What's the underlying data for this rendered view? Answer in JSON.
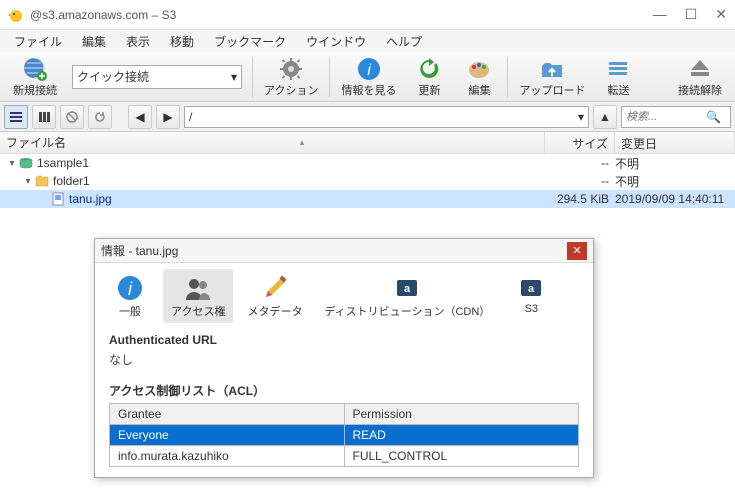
{
  "window": {
    "title": "@s3.amazonaws.com – S3"
  },
  "menu": [
    "ファイル",
    "編集",
    "表示",
    "移動",
    "ブックマーク",
    "ウインドウ",
    "ヘルプ"
  ],
  "toolbar": {
    "new_connection": "新規接続",
    "quick_connect": "クイック接続",
    "action": "アクション",
    "info": "情報を見る",
    "refresh": "更新",
    "edit": "編集",
    "upload": "アップロード",
    "transfer": "転送",
    "disconnect": "接続解除"
  },
  "path": "/",
  "search_placeholder": "検索...",
  "columns": {
    "name": "ファイル名",
    "size": "サイズ",
    "date": "変更日"
  },
  "rows": [
    {
      "name": "1sample1",
      "size": "--",
      "date": "不明",
      "depth": 0,
      "type": "bucket",
      "exp": "▾"
    },
    {
      "name": "folder1",
      "size": "--",
      "date": "不明",
      "depth": 1,
      "type": "folder",
      "exp": "▾"
    },
    {
      "name": "tanu.jpg",
      "size": "294.5 KiB",
      "date": "2019/09/09 14:40:11",
      "depth": 2,
      "type": "file",
      "exp": "",
      "selected": true
    }
  ],
  "dialog": {
    "title": "情報 - tanu.jpg",
    "tabs": {
      "general": "一般",
      "permissions": "アクセス権",
      "metadata": "メタデータ",
      "distribution": "ディストリビューション（CDN）",
      "s3": "S3"
    },
    "auth_url_label": "Authenticated URL",
    "auth_url_value": "なし",
    "acl_label": "アクセス制御リスト（ACL）",
    "acl_header": {
      "grantee": "Grantee",
      "permission": "Permission"
    },
    "acl_rows": [
      {
        "grantee": "Everyone",
        "permission": "READ",
        "selected": true
      },
      {
        "grantee": "info.murata.kazuhiko",
        "permission": "FULL_CONTROL",
        "selected": false
      }
    ]
  }
}
